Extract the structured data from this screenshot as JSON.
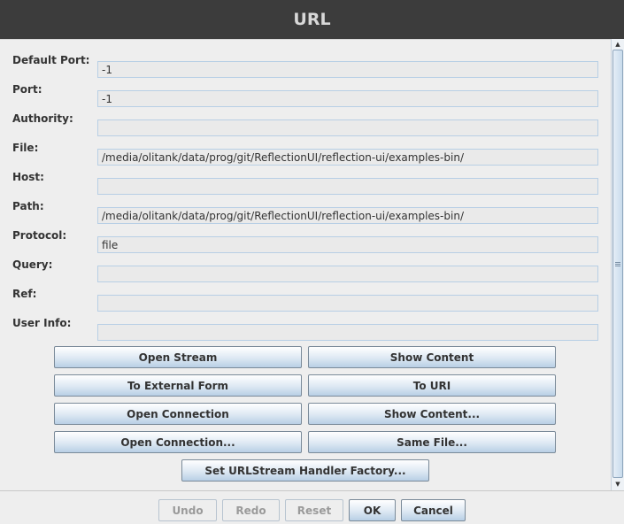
{
  "window": {
    "title": "URL"
  },
  "fields": [
    {
      "label": "Default Port:",
      "value": "-1"
    },
    {
      "label": "Port:",
      "value": "-1"
    },
    {
      "label": "Authority:",
      "value": ""
    },
    {
      "label": "File:",
      "value": "/media/olitank/data/prog/git/ReflectionUI/reflection-ui/examples-bin/"
    },
    {
      "label": "Host:",
      "value": ""
    },
    {
      "label": "Path:",
      "value": "/media/olitank/data/prog/git/ReflectionUI/reflection-ui/examples-bin/"
    },
    {
      "label": "Protocol:",
      "value": "file"
    },
    {
      "label": "Query:",
      "value": ""
    },
    {
      "label": "Ref:",
      "value": ""
    },
    {
      "label": "User Info:",
      "value": ""
    }
  ],
  "methods": {
    "open_stream": "Open Stream",
    "show_content": "Show Content",
    "to_external_form": "To External Form",
    "to_uri": "To URI",
    "open_connection": "Open Connection",
    "show_content_dialog": "Show Content...",
    "open_connection_dialog": "Open Connection...",
    "same_file": "Same File...",
    "set_handler_factory": "Set URLStream Handler Factory..."
  },
  "footer": {
    "undo": "Undo",
    "redo": "Redo",
    "reset": "Reset",
    "ok": "OK",
    "cancel": "Cancel"
  }
}
